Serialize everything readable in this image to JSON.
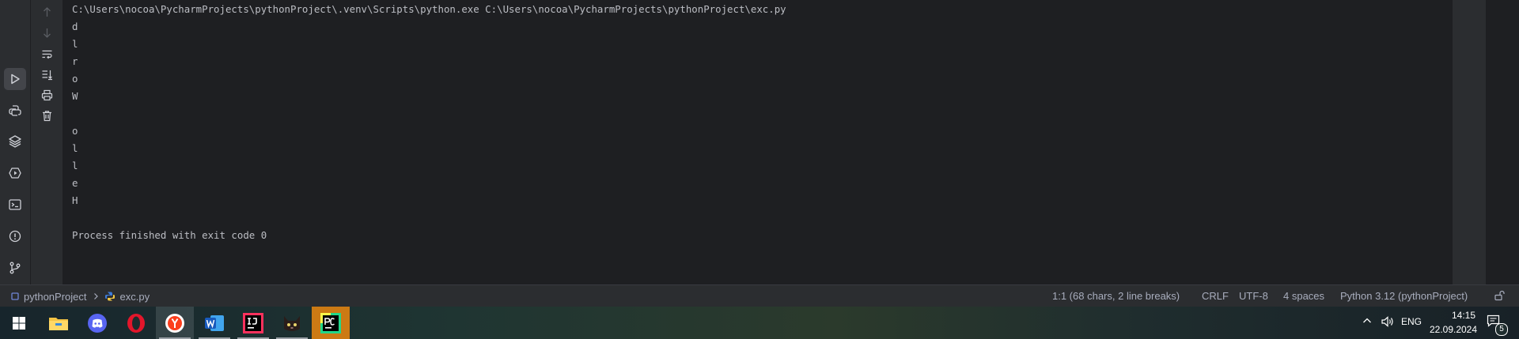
{
  "console": {
    "lines": [
      "C:\\Users\\nocoa\\PycharmProjects\\pythonProject\\.venv\\Scripts\\python.exe C:\\Users\\nocoa\\PycharmProjects\\pythonProject\\exc.py",
      "d",
      "l",
      "r",
      "o",
      "W",
      "",
      "o",
      "l",
      "l",
      "e",
      "H",
      "",
      "Process finished with exit code 0"
    ]
  },
  "left_strip": {
    "tools": [
      {
        "name": "run",
        "icon": "run-icon",
        "active": true
      },
      {
        "name": "python-console",
        "icon": "python-icon",
        "active": false
      },
      {
        "name": "python-packages",
        "icon": "layers-icon",
        "active": false
      },
      {
        "name": "services",
        "icon": "services-icon",
        "active": false
      },
      {
        "name": "terminal",
        "icon": "terminal-icon",
        "active": false
      },
      {
        "name": "problems",
        "icon": "problems-icon",
        "active": false
      },
      {
        "name": "version-control",
        "icon": "git-branch-icon",
        "active": false
      }
    ]
  },
  "console_toolbar": {
    "buttons": [
      "up-arrow-icon",
      "down-arrow-icon",
      "soft-wrap-icon",
      "scroll-to-end-icon",
      "print-icon",
      "trash-icon"
    ]
  },
  "status_bar": {
    "project": "pythonProject",
    "file": "exc.py",
    "position": "1:1 (68 chars, 2 line breaks)",
    "line_separator": "CRLF",
    "encoding": "UTF-8",
    "indent": "4 spaces",
    "interpreter": "Python 3.12 (pythonProject)"
  },
  "taskbar": {
    "apps": [
      "windows-start-icon",
      "file-explorer-icon",
      "discord-icon",
      "opera-icon",
      "yandex-browser-icon",
      "word-icon",
      "intellij-idea-icon",
      "app-cat-icon",
      "pycharm-icon"
    ],
    "tray": {
      "language": "ENG",
      "time": "14:15",
      "date": "22.09.2024",
      "notifications": "5"
    }
  },
  "colors": {
    "editor_bg": "#1e1f22",
    "panel_bg": "#2b2d30",
    "console_text": "#bcbec4",
    "status_text": "#a8adbd"
  }
}
